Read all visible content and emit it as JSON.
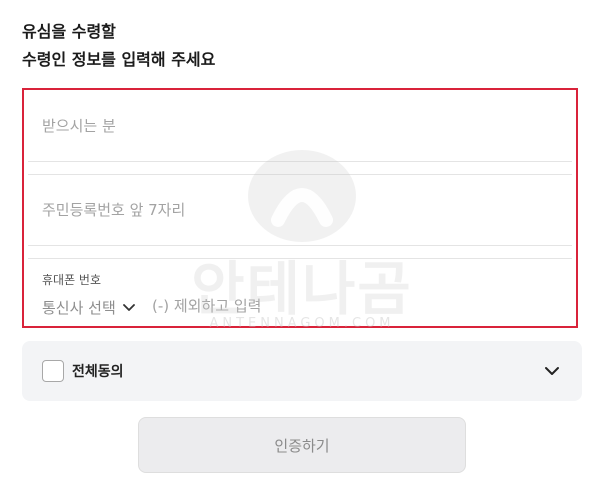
{
  "heading": {
    "line1": "유심을 수령할",
    "line2": "수령인 정보를 입력해 주세요"
  },
  "form": {
    "recipient_placeholder": "받으시는 분",
    "id_placeholder": "주민등록번호 앞 7자리",
    "phone_label": "휴대폰 번호",
    "carrier_select": "통신사 선택",
    "phone_placeholder": "(-) 제외하고 입력",
    "highlight_color": "#d9233a"
  },
  "watermark": {
    "text": "안테나곰",
    "subtext": "ANTENNAGOM.COM"
  },
  "agreement": {
    "label": "전체동의",
    "checked": false
  },
  "submit": {
    "label": "인증하기"
  }
}
